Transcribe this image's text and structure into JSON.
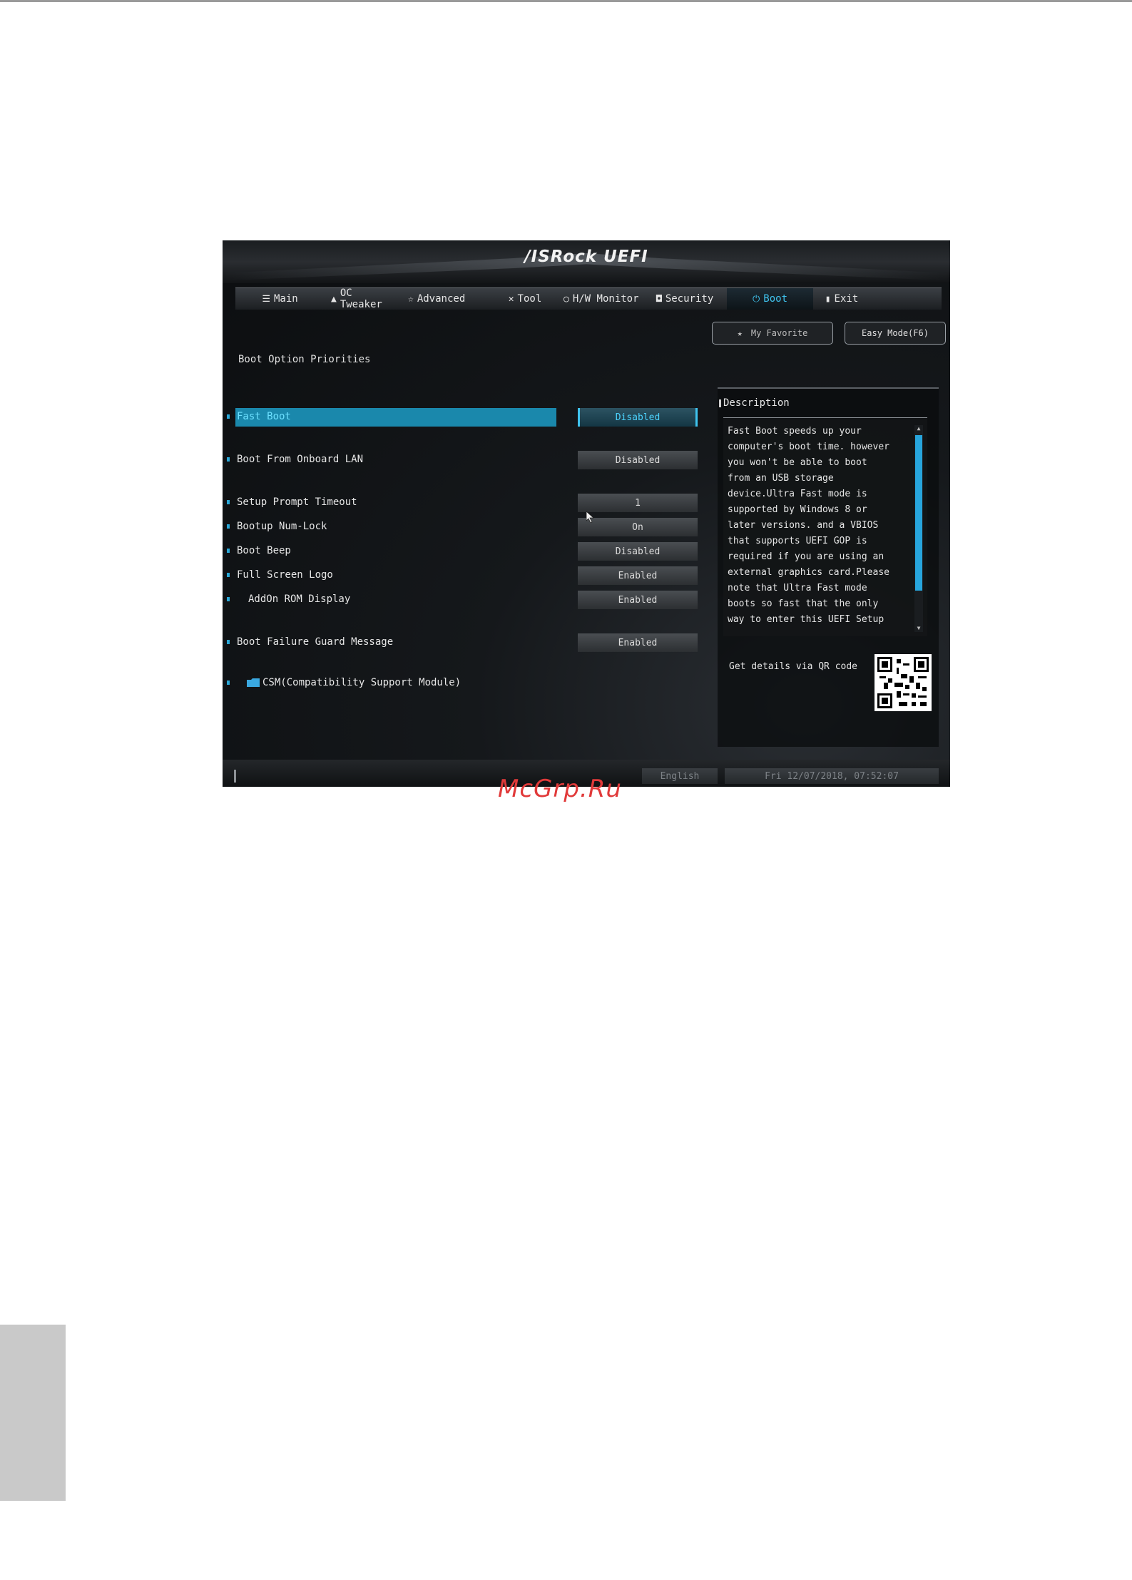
{
  "watermark": "McGrp.Ru",
  "bios": {
    "logo": "/ISRock UEFI",
    "tabs": [
      {
        "label": "Main",
        "icon": "list-icon",
        "glyph": "☰"
      },
      {
        "label": "OC Tweaker",
        "icon": "flame-icon",
        "glyph": "▲"
      },
      {
        "label": "Advanced",
        "icon": "star-icon",
        "glyph": "☆"
      },
      {
        "label": "Tool",
        "icon": "tool-icon",
        "glyph": "✕"
      },
      {
        "label": "H/W Monitor",
        "icon": "monitor-icon",
        "glyph": "○"
      },
      {
        "label": "Security",
        "icon": "shield-icon",
        "glyph": "◘"
      },
      {
        "label": "Boot",
        "icon": "power-icon",
        "glyph": "⏻"
      },
      {
        "label": "Exit",
        "icon": "exit-icon",
        "glyph": "▮"
      }
    ],
    "active_tab": "Boot",
    "my_favorite": "My Favorite",
    "easy_mode": "Easy Mode(F6)",
    "section_title": "Boot Option Priorities",
    "settings": [
      {
        "label": "Fast Boot",
        "value": "Disabled"
      },
      {
        "label": "Boot From Onboard LAN",
        "value": "Disabled"
      },
      {
        "label": "Setup Prompt Timeout",
        "value": "1"
      },
      {
        "label": "Bootup Num-Lock",
        "value": "On"
      },
      {
        "label": "Boot Beep",
        "value": "Disabled"
      },
      {
        "label": "Full Screen Logo",
        "value": "Enabled"
      },
      {
        "label": "AddOn ROM Display",
        "value": "Enabled"
      },
      {
        "label": "Boot Failure Guard Message",
        "value": "Enabled"
      },
      {
        "label": "CSM(Compatibility Support Module)"
      }
    ],
    "description": {
      "title": "Description",
      "text": "Fast Boot speeds up your\ncomputer's boot time. however\nyou won't be able to boot\nfrom an USB storage\ndevice.Ultra Fast mode is\nsupported by Windows 8 or\nlater versions. and a VBIOS\nthat supports UEFI GOP is\nrequired if you are using an\nexternal graphics card.Please\nnote that Ultra Fast mode\nboots so fast that the only\nway to enter this UEFI Setup",
      "qr_label": "Get details via QR code"
    },
    "footer": {
      "language": "English",
      "datetime": "Fri 12/07/2018, 07:52:07"
    },
    "colors": {
      "accent": "#3fc3ee",
      "selected_bar": "#1a88ac",
      "background": "#0c0e10"
    }
  }
}
